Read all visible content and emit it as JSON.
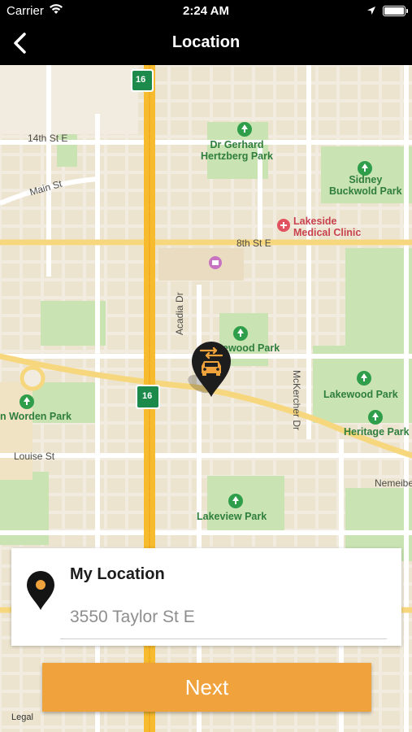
{
  "status_bar": {
    "carrier": "Carrier",
    "time": "2:24 AM"
  },
  "nav": {
    "title": "Location"
  },
  "map": {
    "streets": {
      "fourteenth": "14th St E",
      "main": "Main St",
      "eighth": "8th St E",
      "acadia": "Acadia Dr",
      "mckercher": "McKercher Dr",
      "louise": "Louise St",
      "nemeiben": "Nemeibe"
    },
    "parks": {
      "hertzberg": "Dr Gerhard\nHertzberg Park",
      "sidney": "Sidney\nBuckwold Park",
      "lakewood_small": "ewood Park",
      "lakewood": "Lakewood Park",
      "heritage": "Heritage Park",
      "worden": "n Worden Park",
      "lakeview": "Lakeview Park"
    },
    "clinic": "Lakeside\nMedical Clinic",
    "highway_number": "16",
    "legal": "Legal"
  },
  "location_card": {
    "title": "My Location",
    "address": "3550 Taylor St E"
  },
  "next_button": {
    "label": "Next"
  },
  "colors": {
    "accent": "#f0a23c",
    "park": "#2f7e3c",
    "highway": "#f6bb2e"
  }
}
